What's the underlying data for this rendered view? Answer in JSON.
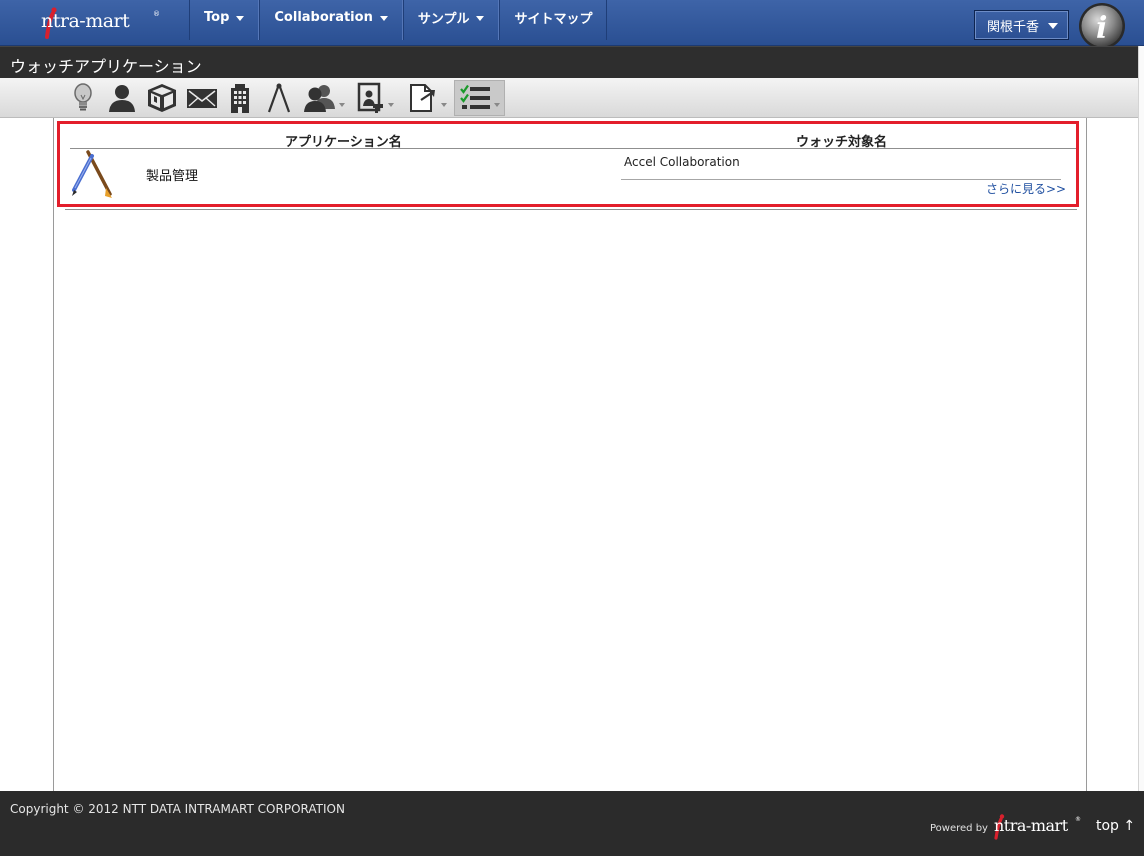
{
  "header": {
    "logo_text": "ntra-mart",
    "logo_reg": "®",
    "nav": [
      {
        "label": "Top",
        "has_menu": true
      },
      {
        "label": "Collaboration",
        "has_menu": true
      },
      {
        "label": "サンプル",
        "has_menu": true
      },
      {
        "label": "サイトマップ",
        "has_menu": false
      }
    ],
    "user_name": "関根千香",
    "app_menu_letter": "i"
  },
  "page": {
    "title": "ウォッチアプリケーション"
  },
  "toolbar": {
    "icons": [
      {
        "name": "lightbulb-icon",
        "has_menu": false
      },
      {
        "name": "person-icon",
        "has_menu": false
      },
      {
        "name": "cube-icon",
        "has_menu": false
      },
      {
        "name": "mail-icon",
        "has_menu": false
      },
      {
        "name": "building-icon",
        "has_menu": false
      },
      {
        "name": "compass-icon",
        "has_menu": false
      },
      {
        "name": "group-icon",
        "has_menu": true
      },
      {
        "name": "portal-icon",
        "has_menu": true
      },
      {
        "name": "document-export-icon",
        "has_menu": true
      },
      {
        "name": "checklist-icon",
        "has_menu": true,
        "active": true
      }
    ]
  },
  "watch_list": {
    "columns": [
      "アプリケーション名",
      "ウォッチ対象名"
    ],
    "rows": [
      {
        "icon": "pencil-brush-icon",
        "application_name": "製品管理",
        "targets": [
          "Accel Collaboration"
        ],
        "more_label": "さらに見る>>"
      }
    ],
    "highlight_color": "#e31e2b"
  },
  "footer": {
    "copyright": "Copyright © 2012 NTT DATA INTRAMART CORPORATION",
    "powered_by": "Powered by",
    "logo_text": "ntra-mart",
    "logo_reg": "®",
    "top_link": "top ↑"
  },
  "colors": {
    "header_bg": "#3e64a8",
    "titlebar_bg": "#2e2e2e",
    "footer_bg": "#2b2b2b",
    "link": "#1f4fa0"
  }
}
